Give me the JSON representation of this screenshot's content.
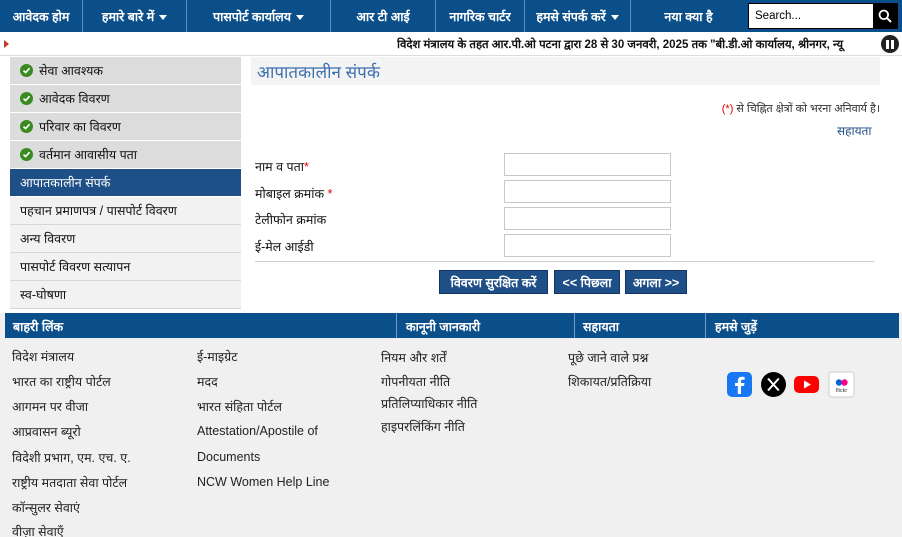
{
  "nav": {
    "items": [
      {
        "label": "आवेदक होम",
        "dropdown": false
      },
      {
        "label": "हमारे बारे में",
        "dropdown": true
      },
      {
        "label": "पासपोर्ट कार्यालय",
        "dropdown": true
      },
      {
        "label": "आर टी आई",
        "dropdown": false
      },
      {
        "label": "नागरिक चार्टर",
        "dropdown": false
      },
      {
        "label": "हमसे संपर्क करें",
        "dropdown": true
      },
      {
        "label": "नया क्या है",
        "dropdown": false
      }
    ],
    "search_placeholder": "Search..."
  },
  "ticker": {
    "text": "विदेश मंत्रालय के तहत आर.पी.ओ पटना द्वारा 28 से 30 जनवरी, 2025 तक \"बी.डी.ओ कार्यालय, श्रीनगर, न्यू"
  },
  "sidebar": {
    "items": [
      {
        "label": "सेवा आवश्यक",
        "state": "done"
      },
      {
        "label": "आवेदक विवरण",
        "state": "done"
      },
      {
        "label": "परिवार का विवरण",
        "state": "done"
      },
      {
        "label": "वर्तमान आवासीय पता",
        "state": "done"
      },
      {
        "label": "आपातकालीन संपर्क",
        "state": "active"
      },
      {
        "label": "पहचान प्रमाणपत्र / पासपोर्ट विवरण",
        "state": "plain"
      },
      {
        "label": "अन्य विवरण",
        "state": "plain"
      },
      {
        "label": "पासपोर्ट विवरण सत्यापन",
        "state": "plain"
      },
      {
        "label": "स्व-घोषणा",
        "state": "plain"
      }
    ]
  },
  "main": {
    "title": "आपातकालीन संपर्क",
    "required_note_star": "(*)",
    "required_note": " से चिह्नित क्षेत्रों को भरना अनिवार्य है।",
    "help": "सहायता",
    "fields": [
      {
        "label": "नाम व पता",
        "required": true,
        "value": ""
      },
      {
        "label": "मोबाइल क्रमांक",
        "required": true,
        "value": ""
      },
      {
        "label": "टेलीफोन क्रमांक",
        "required": false,
        "value": ""
      },
      {
        "label": "ई-मेल आईडी",
        "required": false,
        "value": ""
      }
    ],
    "buttons": {
      "save": "विवरण सुरक्षित करें",
      "prev": "<< पिछला",
      "next": "अगला >>"
    }
  },
  "footer": {
    "headings": {
      "external": "बाहरी लिंक",
      "legal": "कानूनी जानकारी",
      "help": "सहायता",
      "connect": "हमसे जुड़ें"
    },
    "external_col1": [
      "विदेश मंत्रालय",
      "भारत का राष्ट्रीय पोर्टल",
      "आगमन पर वीजा",
      "आप्रवासन ब्यूरो",
      "विदेशी प्रभाग, एम. एच. ए.",
      "राष्ट्रीय मतदाता सेवा पोर्टल",
      "कॉन्सुलर सेवाएं",
      "वीज़ा सेवाएँ"
    ],
    "external_col2": [
      "ई-माइग्रेट",
      "मदद",
      "भारत संहिता पोर्टल",
      "Attestation/Apostile of",
      "Documents",
      "NCW Women Help Line"
    ],
    "legal": [
      "नियम और शर्तें",
      "गोपनीयता नीति",
      "प्रतिलिप्याधिकार नीति",
      "हाइपरलिंकिंग नीति"
    ],
    "help": [
      "पूछे जाने वाले प्रश्न",
      "शिकायत/प्रतिक्रिया"
    ],
    "social": [
      {
        "icon": "facebook-icon",
        "color": "#1877f2"
      },
      {
        "icon": "x-icon",
        "color": "#000000"
      },
      {
        "icon": "youtube-icon",
        "color": "#ff0000"
      },
      {
        "icon": "flickr-icon",
        "color": "#ff0084",
        "text": "flickr"
      }
    ]
  }
}
